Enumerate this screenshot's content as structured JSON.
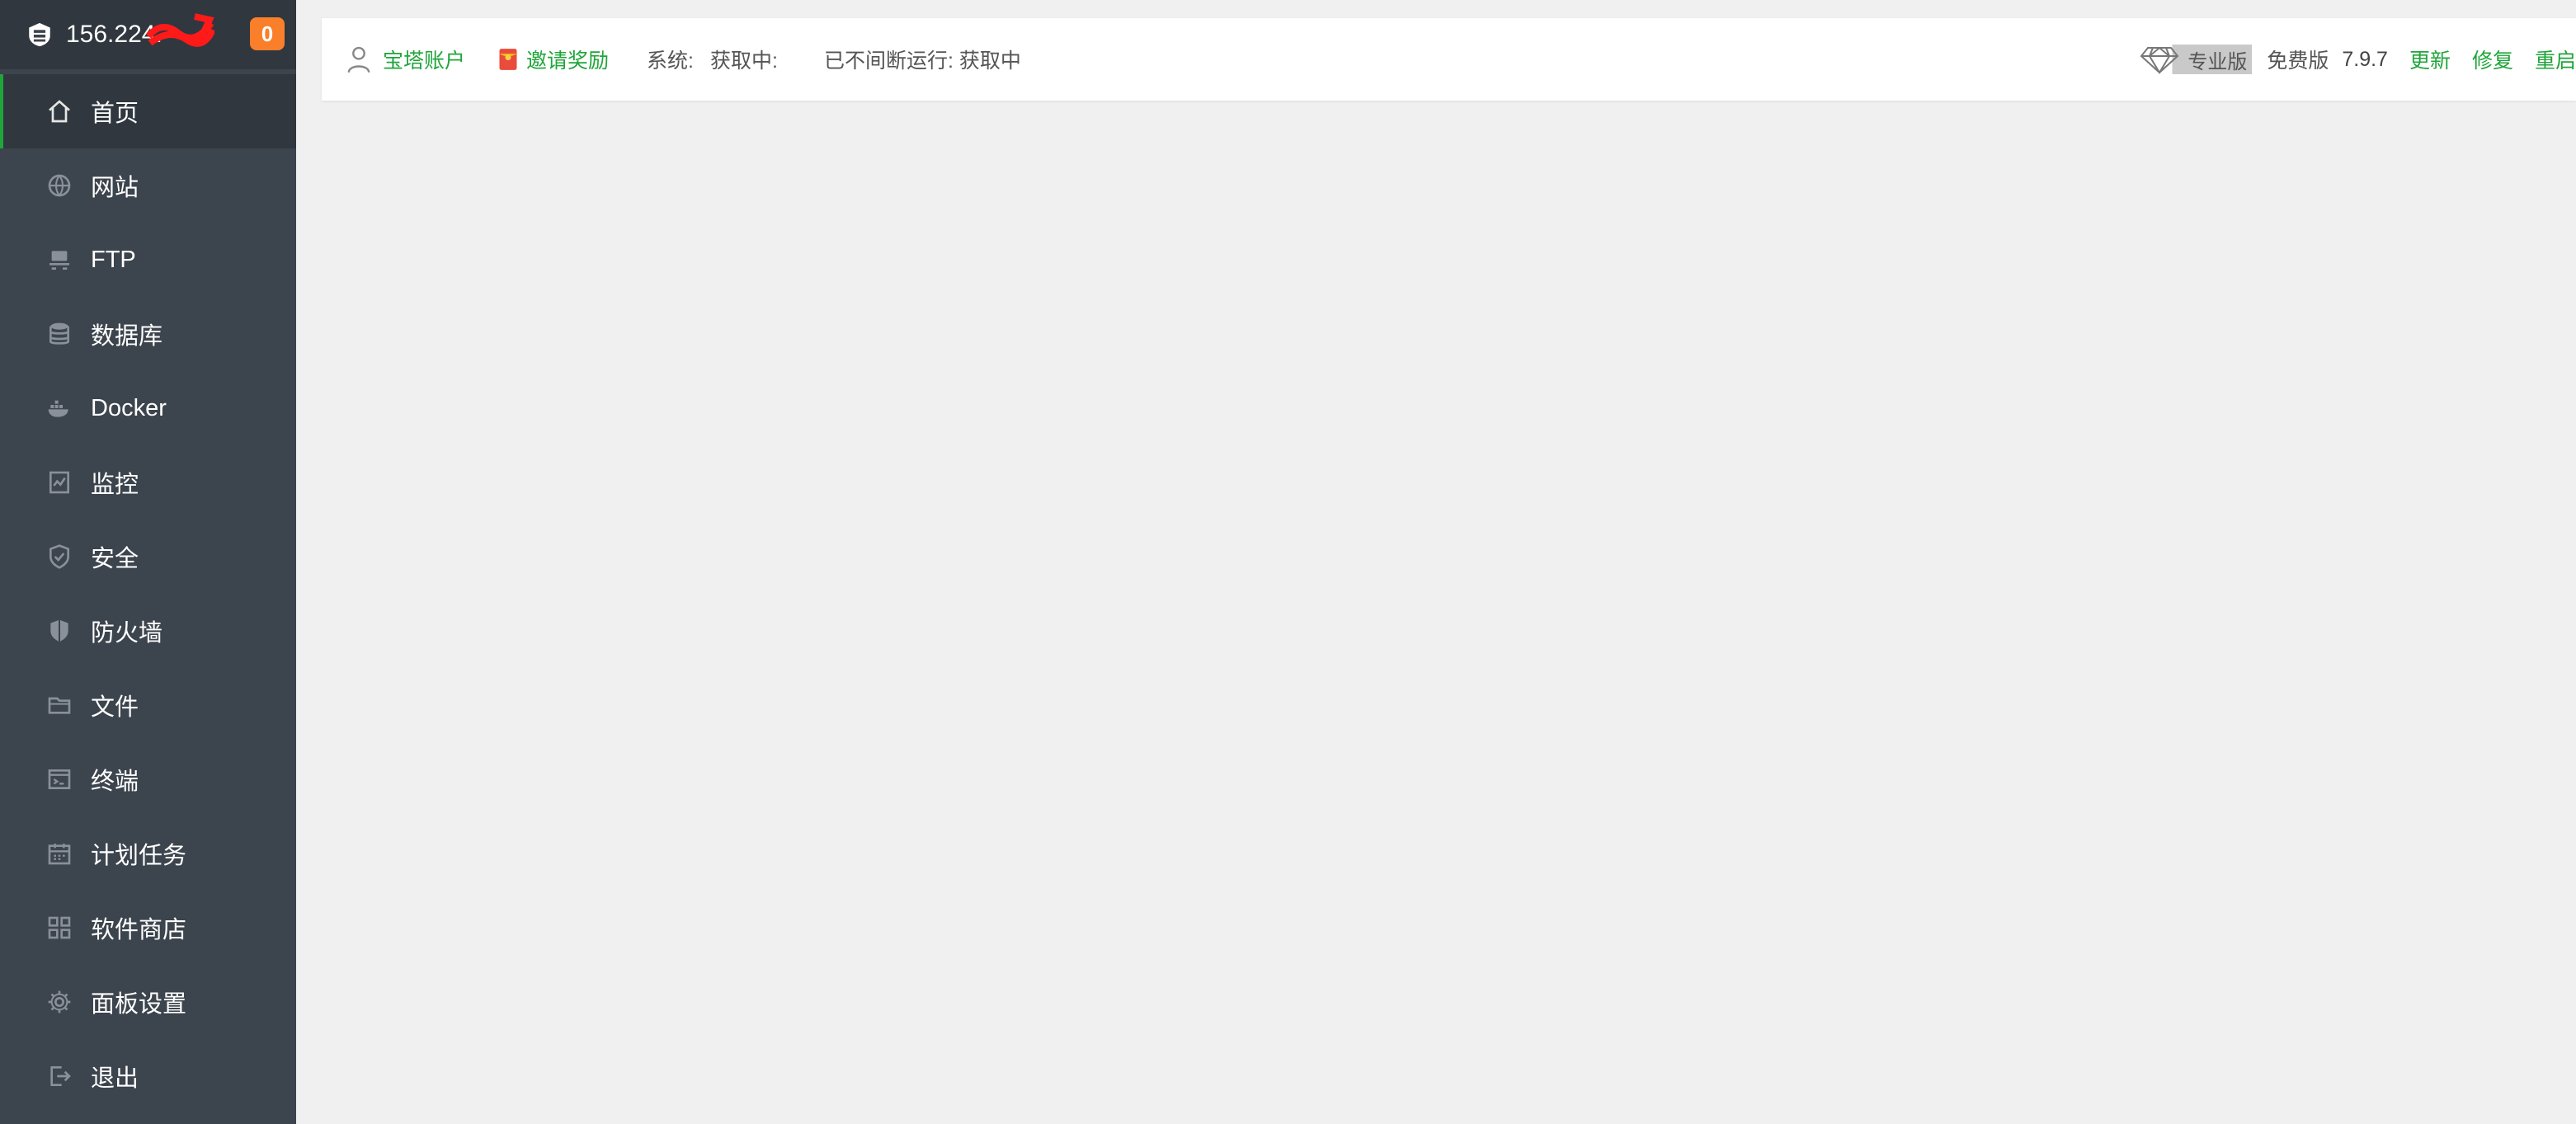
{
  "sidebar": {
    "brand": {
      "ip": "156.224.",
      "badge": "0"
    },
    "items": [
      {
        "label": "首页",
        "icon": "home-icon",
        "active": true
      },
      {
        "label": "网站",
        "icon": "globe-icon"
      },
      {
        "label": "FTP",
        "icon": "ftp-icon"
      },
      {
        "label": "数据库",
        "icon": "database-icon"
      },
      {
        "label": "Docker",
        "icon": "docker-icon"
      },
      {
        "label": "监控",
        "icon": "monitor-icon"
      },
      {
        "label": "安全",
        "icon": "shield-check-icon"
      },
      {
        "label": "防火墙",
        "icon": "firewall-shield-icon"
      },
      {
        "label": "文件",
        "icon": "folder-icon"
      },
      {
        "label": "终端",
        "icon": "terminal-icon"
      },
      {
        "label": "计划任务",
        "icon": "calendar-icon"
      },
      {
        "label": "软件商店",
        "icon": "grid-apps-icon"
      },
      {
        "label": "面板设置",
        "icon": "gear-icon"
      },
      {
        "label": "退出",
        "icon": "logout-icon"
      }
    ]
  },
  "topbar": {
    "account": "宝塔账户",
    "invite": "邀请奖励",
    "system_label": "系统:",
    "system_value": "获取中:",
    "uptime": "已不间断运行: 获取中",
    "pro": "专业版",
    "free": "免费版",
    "version": "7.9.7",
    "update": "更新",
    "repair": "修复",
    "restart": "重启"
  },
  "colors": {
    "accent": "#20a53a",
    "sidebar": "#3c444d",
    "badge": "#fa7f2a"
  }
}
